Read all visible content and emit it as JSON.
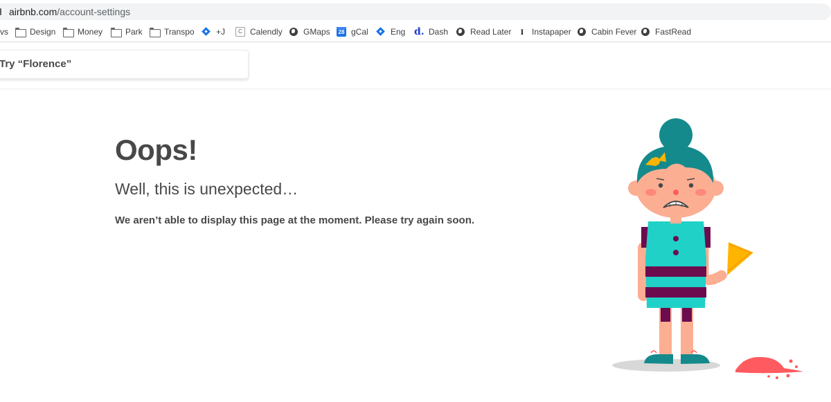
{
  "browser": {
    "url_domain": "airbnb.com",
    "url_path": "/account-settings",
    "bookmarks": [
      {
        "label": "vs",
        "icon": "none"
      },
      {
        "label": "Design",
        "icon": "folder-icon"
      },
      {
        "label": "Money",
        "icon": "folder-icon"
      },
      {
        "label": "Park",
        "icon": "folder-icon"
      },
      {
        "label": "Transpo",
        "icon": "folder-icon"
      },
      {
        "label": "+J",
        "icon": "diamond-icon"
      },
      {
        "label": "Calendly",
        "icon": "calendar-icon"
      },
      {
        "label": "GMaps",
        "icon": "globe-icon"
      },
      {
        "label": "gCal",
        "icon": "google-calendar-icon",
        "icon_text": "28"
      },
      {
        "label": "Eng",
        "icon": "diamond-icon"
      },
      {
        "label": "Dash",
        "icon": "dash-icon",
        "icon_text": "d."
      },
      {
        "label": "Read Later",
        "icon": "globe-icon"
      },
      {
        "label": "Instapaper",
        "icon": "instapaper-icon",
        "icon_text": "I"
      },
      {
        "label": "Cabin Fever",
        "icon": "globe-icon"
      },
      {
        "label": "FastRead",
        "icon": "globe-icon"
      }
    ]
  },
  "search": {
    "placeholder": "Try “Florence”"
  },
  "error": {
    "title": "Oops!",
    "subtitle": "Well, this is unexpected…",
    "description": "We aren’t able to display this page at the moment. Please try again soon."
  },
  "colors": {
    "text": "#484848",
    "teal": "#148a8c",
    "aqua": "#1fd1c7",
    "plum": "#6d0b4f",
    "skin": "#fcae93",
    "yellow": "#ffb400",
    "ice_cream": "#ff5a5f"
  }
}
